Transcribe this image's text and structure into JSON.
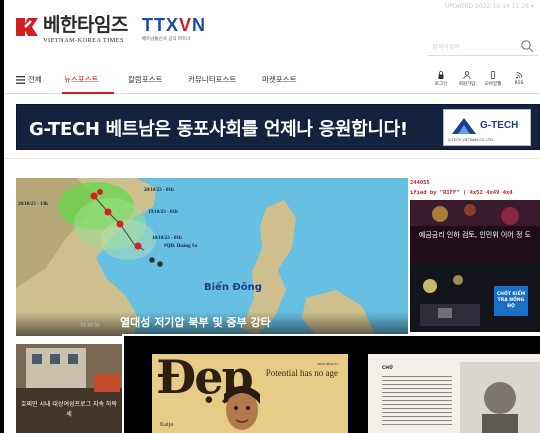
{
  "header": {
    "top_info": "UPDATED 2022-10-14 11:28 ▾",
    "logo_korean": "베한타임즈",
    "logo_english": "VIETNAM-KOREA TIMES",
    "partner_logo": "TTXVN",
    "partner_tagline": "베트남통신사 공식 파트너"
  },
  "search": {
    "placeholder": "검색어입력"
  },
  "nav": {
    "all_label": "전체",
    "items": [
      "뉴스포스트",
      "칼럼포스트",
      "커뮤니티포스트",
      "마켓포스트"
    ],
    "active_item": "뉴스포스트",
    "utilities": [
      "로그인",
      "회원가입",
      "모바일웹",
      "RSS"
    ]
  },
  "banner": {
    "text": "G-TECH 베트남은 동포사회를 언제나 응원합니다!",
    "logo_word": "G-TECH",
    "logo_sub": "G-TECH VIETNAM CO.,LTD."
  },
  "featured": {
    "headline": "열대성 저기압 북부 및 중부 강타",
    "map_labels": {
      "sea": "Biển Đông",
      "islands": "#QĐ. Hoàng Sa",
      "city": "TP HCM",
      "timestamps": [
        "20/10/23 - 01h",
        "20/10/23 - 13h",
        "19/10/23 - 01h",
        "18/10/23 - 01h"
      ]
    }
  },
  "right_column": {
    "ticker_line1": "244055",
    "ticker_line2": "ified by \"RIFF\" ( 4x52 4x49 4x4",
    "card1_text": "예금금리 인하 검토, 인민위 이어 정 도",
    "card2_sign": "CHỐT KIỂM TRA NỒNG ĐỘ"
  },
  "bottom_left": {
    "text": "호찌민 시내 대상여성프로그 지속 하락세"
  },
  "overlay": {
    "mag_title": "Đẹp",
    "mag_tag": "Potential has no age",
    "mag_small": "TRUE BEAUTY",
    "mag_bottom": "Kaija",
    "page_label": "CHỮ"
  },
  "colors": {
    "brand_red": "#d21e1e",
    "banner_bg": "#14213f",
    "map_sea": "#67bfe2",
    "ttx_blue": "#1a4aa8"
  }
}
